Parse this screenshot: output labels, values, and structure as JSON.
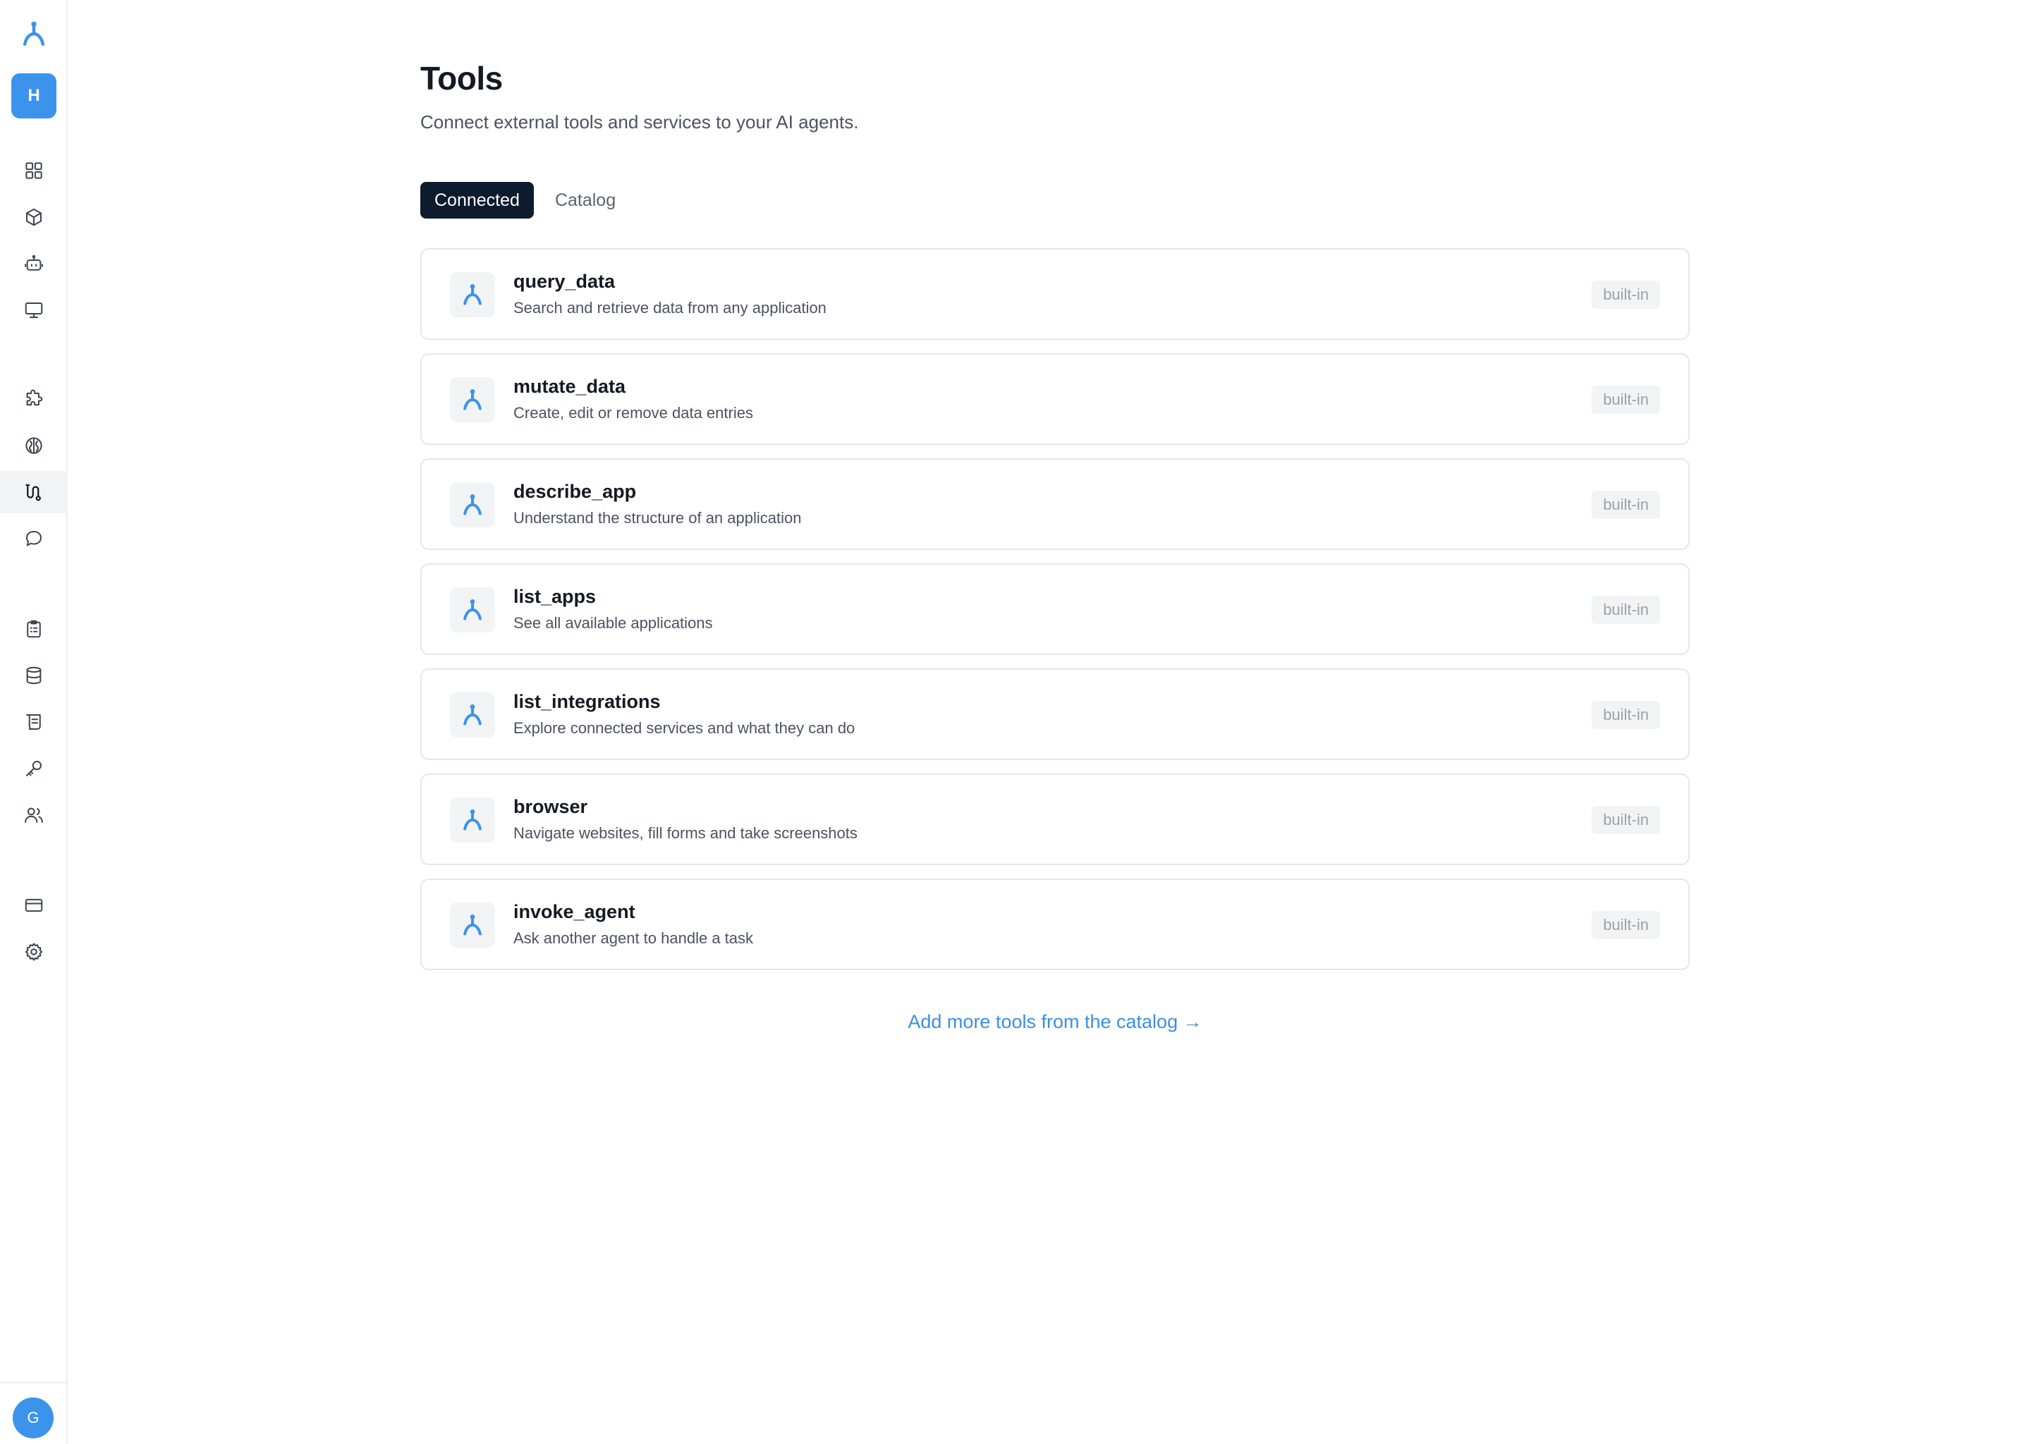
{
  "sidebar": {
    "workspace_initial": "H",
    "user_initial": "G",
    "items": [
      {
        "icon": "grid-icon",
        "active": false
      },
      {
        "icon": "cube-icon",
        "active": false
      },
      {
        "icon": "robot-icon",
        "active": false
      },
      {
        "icon": "monitor-icon",
        "active": false
      },
      {
        "icon": "puzzle-icon",
        "active": false
      },
      {
        "icon": "brain-icon",
        "active": false
      },
      {
        "icon": "tools-icon",
        "active": true
      },
      {
        "icon": "chat-bubble-icon",
        "active": false
      },
      {
        "icon": "clipboard-icon",
        "active": false
      },
      {
        "icon": "database-icon",
        "active": false
      },
      {
        "icon": "scroll-icon",
        "active": false
      },
      {
        "icon": "key-icon",
        "active": false
      },
      {
        "icon": "users-icon",
        "active": false
      },
      {
        "icon": "credit-card-icon",
        "active": false
      },
      {
        "icon": "gear-icon",
        "active": false
      }
    ]
  },
  "page": {
    "title": "Tools",
    "subtitle": "Connect external tools and services to your AI agents."
  },
  "tabs": [
    {
      "label": "Connected",
      "active": true
    },
    {
      "label": "Catalog",
      "active": false
    }
  ],
  "tools": [
    {
      "name": "query_data",
      "description": "Search and retrieve data from any application",
      "badge": "built-in"
    },
    {
      "name": "mutate_data",
      "description": "Create, edit or remove data entries",
      "badge": "built-in"
    },
    {
      "name": "describe_app",
      "description": "Understand the structure of an application",
      "badge": "built-in"
    },
    {
      "name": "list_apps",
      "description": "See all available applications",
      "badge": "built-in"
    },
    {
      "name": "list_integrations",
      "description": "Explore connected services and what they can do",
      "badge": "built-in"
    },
    {
      "name": "browser",
      "description": "Navigate websites, fill forms and take screenshots",
      "badge": "built-in"
    },
    {
      "name": "invoke_agent",
      "description": "Ask another agent to handle a task",
      "badge": "built-in"
    }
  ],
  "footer": {
    "catalog_link": "Add more tools from the catalog →"
  },
  "colors": {
    "accent": "#3b93ec",
    "active_tab": "#0d1b2e",
    "link": "#3b8fe6"
  }
}
